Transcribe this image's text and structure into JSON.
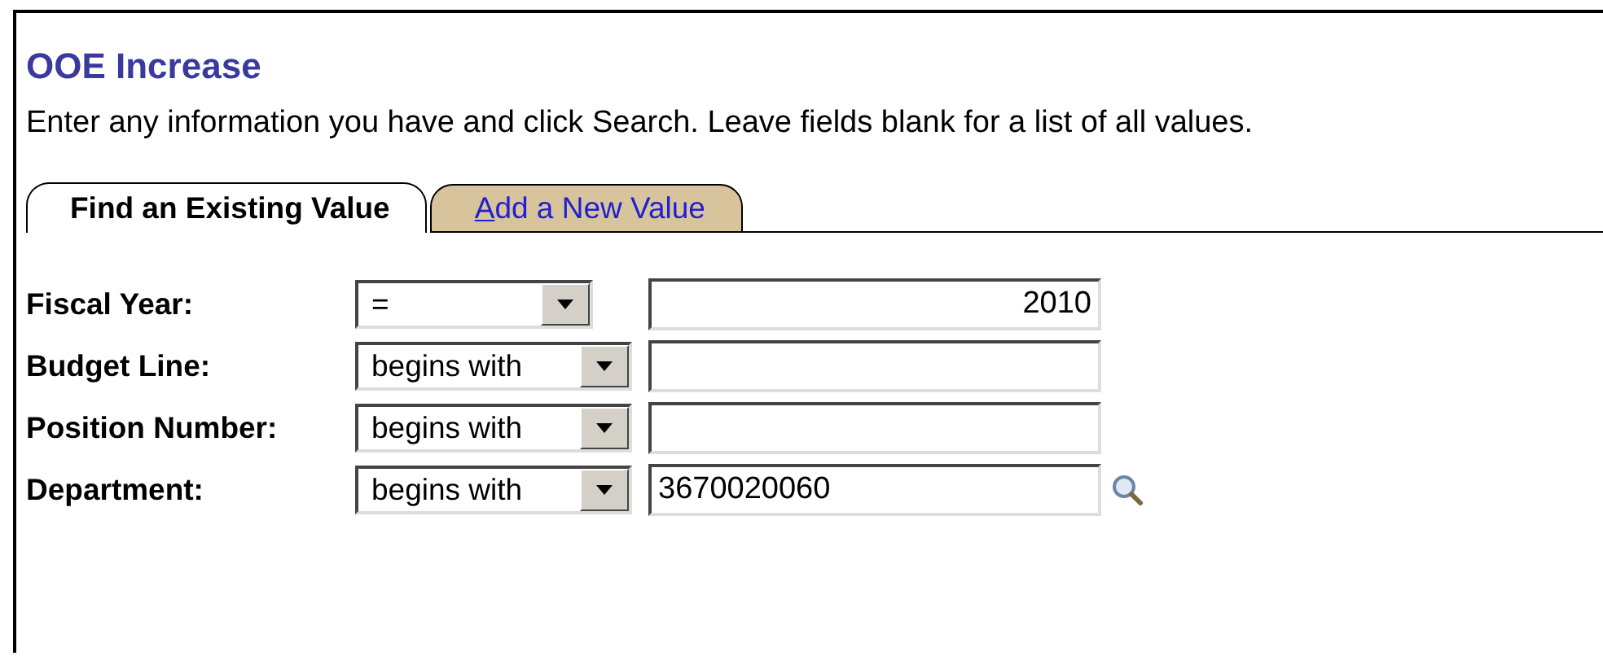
{
  "title": "OOE Increase",
  "instructions": "Enter any information you have and click Search. Leave fields blank for a list of all values.",
  "tabs": [
    {
      "label": "Find an Existing Value",
      "selected": true
    },
    {
      "label": "Add a New Value",
      "selected": false
    }
  ],
  "fields": [
    {
      "label": "Fiscal Year:",
      "operator": "=",
      "value": "2010",
      "kind": "number",
      "lookup": false
    },
    {
      "label": "Budget Line:",
      "operator": "begins with",
      "kind": "text",
      "lookup": false
    },
    {
      "label": "Position Number:",
      "operator": "begins with",
      "kind": "text",
      "lookup": false
    },
    {
      "label": "Department:",
      "operator": "begins with",
      "value": "3670020060",
      "kind": "text",
      "lookup": true
    }
  ]
}
